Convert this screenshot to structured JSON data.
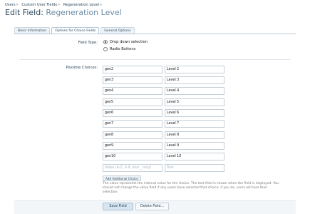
{
  "breadcrumbs": [
    "Users",
    "Custom User Fields",
    "Regeneration Level"
  ],
  "breadcrumb_separator": "»",
  "header": {
    "title_prefix": "Edit Field:",
    "title_name": "Regeneration Level"
  },
  "tabs": [
    {
      "label": "Basic Information",
      "active": false
    },
    {
      "label": "Options for Choice Fields",
      "active": true
    },
    {
      "label": "General Options",
      "active": false
    }
  ],
  "field_type": {
    "label": "Field Type:",
    "options": [
      {
        "label": "Drop down selection",
        "checked": true
      },
      {
        "label": "Radio Buttons",
        "checked": false
      }
    ]
  },
  "possible_choices": {
    "label": "Possible Choices:",
    "rows": [
      {
        "value": "gen2",
        "text": "Level 2"
      },
      {
        "value": "gen3",
        "text": "Level 3"
      },
      {
        "value": "gen4",
        "text": "Level 4"
      },
      {
        "value": "gen5",
        "text": "Level 5"
      },
      {
        "value": "gen6",
        "text": "Level 6"
      },
      {
        "value": "gen7",
        "text": "Level 7"
      },
      {
        "value": "gen8",
        "text": "Level 8"
      },
      {
        "value": "gen9",
        "text": "Level 9"
      },
      {
        "value": "gen10",
        "text": "Level 10"
      }
    ],
    "new_value_placeholder": "Value (A-Z, 0-9, and _ only)",
    "new_text_placeholder": "Text",
    "add_button": "Add Additional Choice",
    "explain": "The value represents the internal value for the choice. The text field is shown when the field is displayed. You should not change the value field if any users have selected that choice; if you do, users will lose their selection."
  },
  "actions": {
    "save": "Save Field",
    "delete": "Delete Field..."
  }
}
